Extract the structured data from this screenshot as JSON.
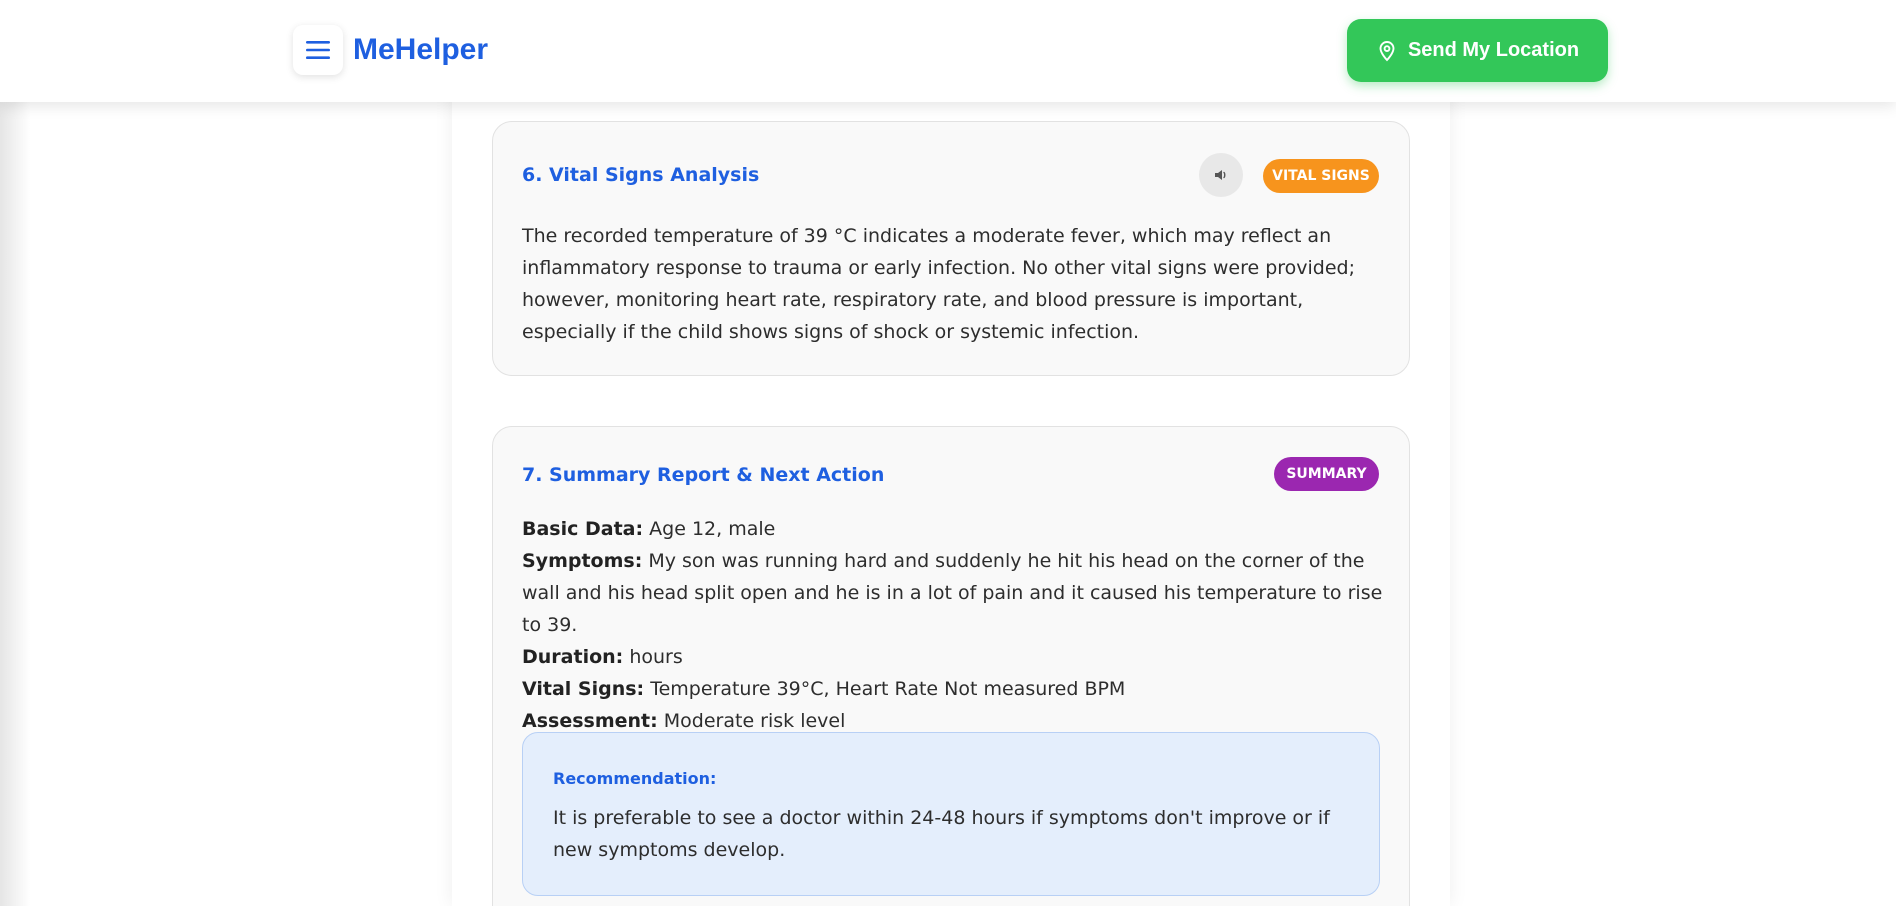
{
  "header": {
    "brand": "MeHelper",
    "location_button": "Send My Location"
  },
  "colors": {
    "brand_blue": "#1e5fe0",
    "location_green": "#33c759",
    "vital_badge": "#f7941d",
    "summary_badge": "#9b27b0",
    "recommendation_bg": "#e4eefc"
  },
  "icons": {
    "menu": "hamburger-menu-icon",
    "location": "map-pin-icon",
    "speaker": "speaker-icon"
  },
  "vital_card": {
    "title": "6. Vital Signs Analysis",
    "badge": "VITAL SIGNS",
    "text": "The recorded temperature of 39 °C indicates a moderate fever, which may reflect an inflammatory response to trauma or early infection. No other vital signs were provided; however, monitoring heart rate, respiratory rate, and blood pressure is important, especially if the child shows signs of shock or systemic infection."
  },
  "summary_card": {
    "title": "7. Summary Report & Next Action",
    "badge": "SUMMARY",
    "fields": [
      {
        "label": "Basic Data:",
        "value": "Age 12, male"
      },
      {
        "label": "Symptoms:",
        "value": "My son was running hard and suddenly he hit his head on the corner of the wall and his head split open and he is in a lot of pain and it caused his temperature to rise to 39."
      },
      {
        "label": "Duration:",
        "value": "hours"
      },
      {
        "label": "Vital Signs:",
        "value": "Temperature 39°C, Heart Rate Not measured BPM"
      },
      {
        "label": "Assessment:",
        "value": "Moderate risk level"
      }
    ],
    "recommendation": {
      "title": "Recommendation:",
      "text": "It is preferable to see a doctor within 24-48 hours if symptoms don't improve or if new symptoms develop."
    }
  }
}
